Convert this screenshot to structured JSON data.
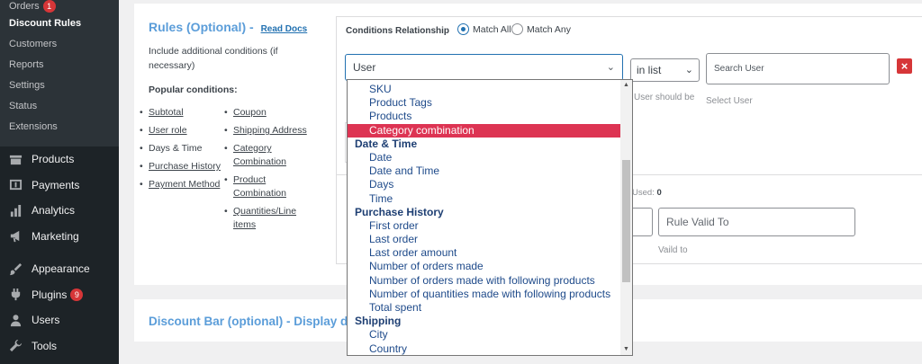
{
  "sidebar": {
    "submenu": [
      {
        "label": "Orders",
        "badge": "1",
        "current": false
      },
      {
        "label": "Discount Rules",
        "current": true
      },
      {
        "label": "Customers"
      },
      {
        "label": "Reports"
      },
      {
        "label": "Settings"
      },
      {
        "label": "Status"
      },
      {
        "label": "Extensions"
      }
    ],
    "menu": [
      {
        "label": "Products",
        "icon": "products-icon"
      },
      {
        "label": "Payments",
        "icon": "payments-icon"
      },
      {
        "label": "Analytics",
        "icon": "analytics-icon"
      },
      {
        "label": "Marketing",
        "icon": "marketing-icon"
      },
      {
        "label": "Appearance",
        "icon": "appearance-icon"
      },
      {
        "label": "Plugins",
        "icon": "plugins-icon",
        "badge": "9"
      },
      {
        "label": "Users",
        "icon": "users-icon"
      },
      {
        "label": "Tools",
        "icon": "tools-icon"
      }
    ]
  },
  "rules": {
    "title": "Rules (Optional) -",
    "read_docs": "Read Docs",
    "description": "Include additional conditions (if necessary)",
    "popular_label": "Popular conditions:",
    "col1": [
      "Subtotal",
      "User role",
      "Days & Time",
      "Purchase History",
      "Payment Method"
    ],
    "col2": [
      "Coupon",
      "Shipping Address",
      "Category Combination",
      "Product Combination",
      "Quantities/Line items"
    ]
  },
  "conditions": {
    "relationship_label": "Conditions Relationship",
    "match_all": "Match All",
    "match_any": "Match Any",
    "type_value": "User",
    "operator_value": "in list",
    "search_placeholder": "Search User",
    "hint_operator": "User should be",
    "hint_search": "Select User",
    "delete": "×"
  },
  "validity": {
    "used_label": "Used:",
    "used_value": "0",
    "valid_to_placeholder": "Rule Valid To",
    "valid_to_hint": "Vaild to"
  },
  "discount_bar": {
    "title": "Discount Bar (optional) - Display d"
  },
  "dropdown": {
    "items": [
      {
        "type": "opt",
        "label": "SKU"
      },
      {
        "type": "opt",
        "label": "Product Tags"
      },
      {
        "type": "opt",
        "label": "Products"
      },
      {
        "type": "opt",
        "label": "Category combination",
        "highlighted": true
      },
      {
        "type": "grp",
        "label": "Date & Time"
      },
      {
        "type": "opt",
        "label": "Date"
      },
      {
        "type": "opt",
        "label": "Date and Time"
      },
      {
        "type": "opt",
        "label": "Days"
      },
      {
        "type": "opt",
        "label": "Time"
      },
      {
        "type": "grp",
        "label": "Purchase History"
      },
      {
        "type": "opt",
        "label": "First order"
      },
      {
        "type": "opt",
        "label": "Last order"
      },
      {
        "type": "opt",
        "label": "Last order amount"
      },
      {
        "type": "opt",
        "label": "Number of orders made"
      },
      {
        "type": "opt",
        "label": "Number of orders made with following products"
      },
      {
        "type": "opt",
        "label": "Number of quantities made with following products"
      },
      {
        "type": "opt",
        "label": "Total spent"
      },
      {
        "type": "grp",
        "label": "Shipping"
      },
      {
        "type": "opt",
        "label": "City"
      },
      {
        "type": "opt",
        "label": "Country"
      }
    ]
  },
  "colors": {
    "sidebar_bg": "#1d2327",
    "accent": "#2271b1",
    "highlight": "#dd3453",
    "danger": "#d63638"
  }
}
